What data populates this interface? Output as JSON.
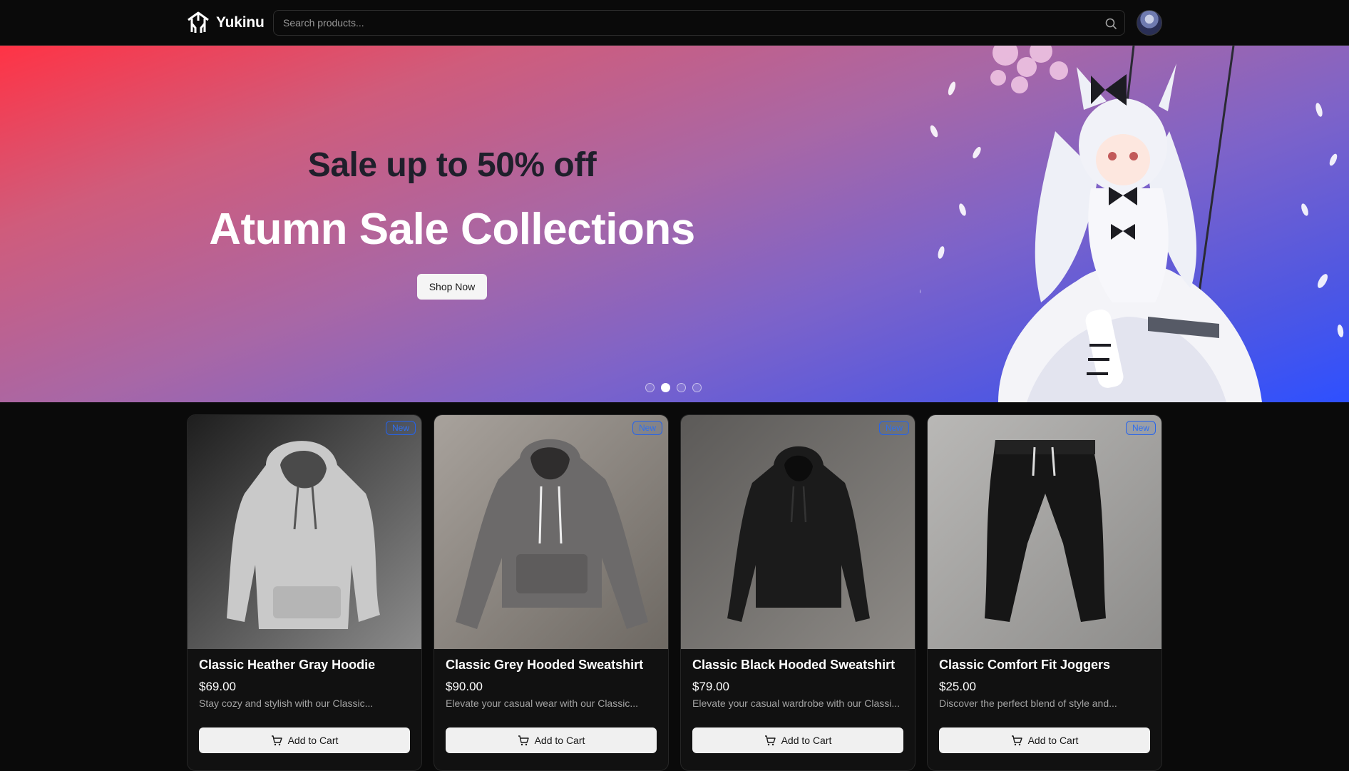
{
  "brand": {
    "name": "Yukinu"
  },
  "search": {
    "placeholder": "Search products..."
  },
  "hero": {
    "subtitle": "Sale up to 50% off",
    "title": "Atumn Sale Collections",
    "cta_label": "Shop Now",
    "slide_count": 4,
    "active_slide": 2
  },
  "colors": {
    "accent": "#2563eb",
    "hero_gradient": [
      "#ff3345",
      "#a867a6",
      "#2e50ff"
    ],
    "background": "#0a0a0a"
  },
  "products": [
    {
      "badge": "New",
      "title": "Classic Heather Gray Hoodie",
      "price": "$69.00",
      "description": "Stay cozy and stylish with our Classic...",
      "button": "Add to Cart"
    },
    {
      "badge": "New",
      "title": "Classic Grey Hooded Sweatshirt",
      "price": "$90.00",
      "description": "Elevate your casual wear with our Classic...",
      "button": "Add to Cart"
    },
    {
      "badge": "New",
      "title": "Classic Black Hooded Sweatshirt",
      "price": "$79.00",
      "description": "Elevate your casual wardrobe with our Classi...",
      "button": "Add to Cart"
    },
    {
      "badge": "New",
      "title": "Classic Comfort Fit Joggers",
      "price": "$25.00",
      "description": "Discover the perfect blend of style and...",
      "button": "Add to Cart"
    }
  ]
}
